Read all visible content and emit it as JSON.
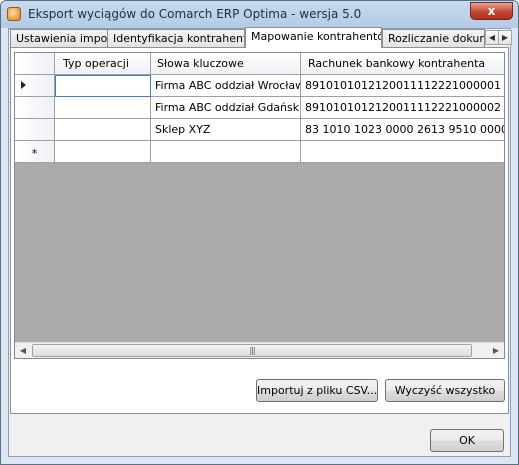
{
  "window": {
    "title": "Eksport wyciągów do Comarch ERP Optima - wersja 5.0",
    "close_label": "x"
  },
  "tabs": [
    {
      "label": "Ustawienia importu"
    },
    {
      "label": "Identyfikacja kontrahentów"
    },
    {
      "label": "Mapowanie kontrahentów"
    },
    {
      "label": "Rozliczanie dokume"
    }
  ],
  "active_tab": "Mapowanie kontrahentów",
  "grid": {
    "columns": [
      "Typ operacji",
      "Słowa kluczowe",
      "Rachunek bankowy kontrahenta"
    ],
    "rows": [
      {
        "typ": "",
        "slowa": "Firma ABC oddział Wrocław",
        "rachunek": "89101010121200111122210000​01"
      },
      {
        "typ": "",
        "slowa": "Firma ABC oddział Gdańsk",
        "rachunek": "89101010121200111122210000​02"
      },
      {
        "typ": "",
        "slowa": "Sklep XYZ",
        "rachunek": "83 1010 1023 0000 2613 9510 0000"
      }
    ],
    "new_row_marker": "*"
  },
  "buttons": {
    "import_csv": "Importuj z pliku CSV...",
    "clear_all": "Wyczyść wszystko",
    "ok": "OK"
  }
}
